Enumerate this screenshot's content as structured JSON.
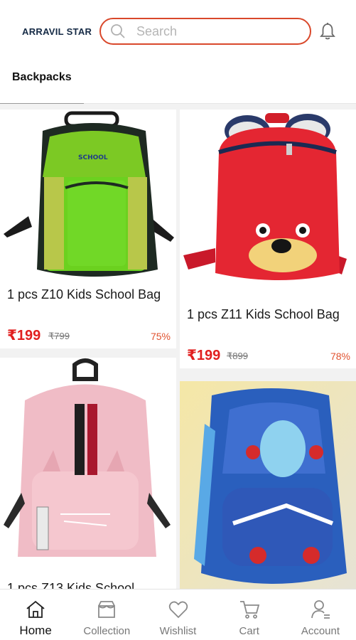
{
  "header": {
    "brand": "ARRAVIL STAR",
    "search_placeholder": "Search",
    "search_icon": "search-icon",
    "bell_icon": "bell-icon"
  },
  "tabs": [
    {
      "label": "Backpacks",
      "active": true
    }
  ],
  "products": [
    {
      "title": "1 pcs Z10 Kids School Bag",
      "price": "₹199",
      "mrp": "₹799",
      "discount": "75%"
    },
    {
      "title": "1 pcs Z11 Kids School Bag",
      "price": "₹199",
      "mrp": "₹899",
      "discount": "78%"
    },
    {
      "title": "1 pcs Z13 Kids School"
    },
    {
      "title": ""
    }
  ],
  "bottom_nav": [
    {
      "label": "Home",
      "icon": "home-icon",
      "active": true
    },
    {
      "label": "Collection",
      "icon": "collection-icon"
    },
    {
      "label": "Wishlist",
      "icon": "heart-icon"
    },
    {
      "label": "Cart",
      "icon": "cart-icon"
    },
    {
      "label": "Account",
      "icon": "account-icon"
    }
  ],
  "colors": {
    "accent": "#d9482b",
    "price": "#e11f1f",
    "discount": "#e0522f",
    "brand": "#152a45"
  }
}
